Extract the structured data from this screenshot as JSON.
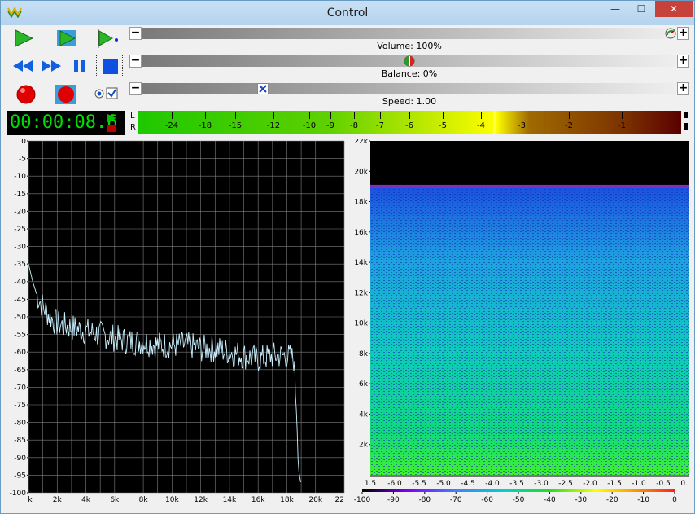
{
  "window": {
    "title": "Control",
    "minimize": "—",
    "maximize": "☐",
    "close": "✕"
  },
  "sliders": {
    "volume": {
      "label": "Volume: 100%",
      "minus": "−",
      "plus": "+",
      "value_fraction": 1.0
    },
    "balance": {
      "label": "Balance: 0%",
      "minus": "−",
      "plus": "+",
      "value_fraction": 0.5
    },
    "speed": {
      "label": "Speed: 1.00",
      "minus": "−",
      "plus": "+",
      "value_fraction": 0.22
    }
  },
  "transport": {
    "time": "00:00:08.6",
    "buttons": [
      "play-icon",
      "play-loop-icon",
      "play-from-icon",
      "rewind-icon",
      "fast-forward-icon",
      "pause-icon",
      "stop-icon",
      "record-icon",
      "record-stop-icon",
      "monitor-icon"
    ]
  },
  "vu_meter": {
    "channels": [
      "L",
      "R"
    ],
    "ticks": [
      "-24",
      "-18",
      "-15",
      "-12",
      "-10",
      "-9",
      "-8",
      "-7",
      "-6",
      "-5",
      "-4",
      "-3",
      "-2",
      "-1"
    ],
    "level_db": -3.7
  },
  "colors": {
    "titlebar": "#b9d7f1",
    "time_text": "#00e000",
    "spectrum_line": "#c8f0ff",
    "grid": "#808080",
    "close_button": "#c7423a"
  },
  "chart_data": [
    {
      "type": "line",
      "xlabel": "",
      "ylabel": "",
      "x_ticks": [
        "k",
        "2k",
        "4k",
        "6k",
        "8k",
        "10k",
        "12k",
        "14k",
        "16k",
        "18k",
        "20k",
        "22"
      ],
      "y_ticks": [
        "0",
        "-5",
        "-10",
        "-15",
        "-20",
        "-25",
        "-30",
        "-35",
        "-40",
        "-45",
        "-50",
        "-55",
        "-60",
        "-65",
        "-70",
        "-75",
        "-80",
        "-85",
        "-90",
        "-95",
        "-100"
      ],
      "xlim": [
        0,
        22
      ],
      "ylim": [
        -100,
        0
      ],
      "grid": true,
      "series": [
        {
          "x": [
            0,
            0.3,
            0.6,
            1,
            1.5,
            2,
            3,
            4,
            5,
            6,
            7,
            8,
            9,
            10,
            11,
            12,
            13,
            14,
            15,
            16,
            17,
            18,
            18.5,
            18.7,
            18.8,
            19
          ],
          "y": [
            -35,
            -40,
            -44,
            -47,
            -50,
            -52,
            -53,
            -54,
            -55,
            -56,
            -57,
            -57,
            -58,
            -58,
            -58,
            -59,
            -59,
            -60,
            -61,
            -62,
            -61,
            -61,
            -62,
            -80,
            -93,
            -98
          ]
        }
      ]
    },
    {
      "type": "heatmap",
      "y_ticks": [
        "2k",
        "4k",
        "6k",
        "8k",
        "10k",
        "12k",
        "14k",
        "16k",
        "18k",
        "20k",
        "22k"
      ],
      "ylim": [
        0,
        22
      ],
      "x_ticks": [
        "1.5",
        "-6.0",
        "-5.5",
        "-5.0",
        "-4.5",
        "-4.0",
        "-3.5",
        "-3.0",
        "-2.5",
        "-2.0",
        "-1.5",
        "-1.0",
        "-0.5",
        "0."
      ],
      "colorbar_ticks": [
        "-100",
        "-90",
        "-80",
        "-70",
        "-60",
        "-50",
        "-40",
        "-30",
        "-20",
        "-10",
        "0"
      ],
      "cutoff_khz": 19
    }
  ]
}
